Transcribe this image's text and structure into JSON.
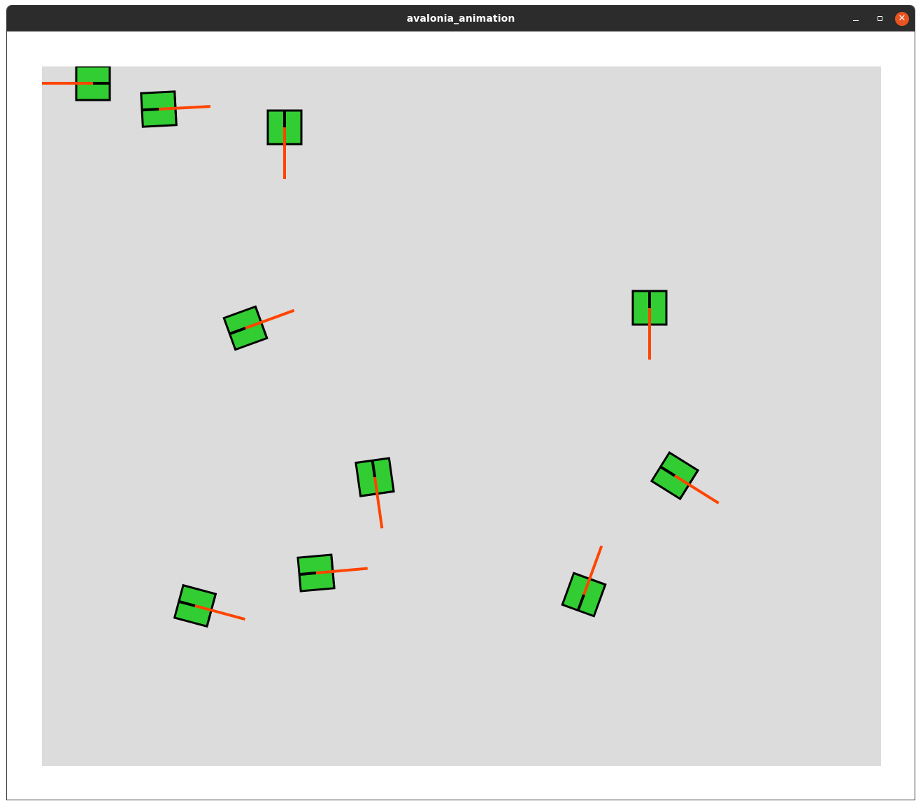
{
  "window": {
    "title": "avalonia_animation",
    "controls": {
      "minimize_icon": "minimize-icon",
      "maximize_icon": "maximize-icon",
      "close_icon": "close-icon",
      "close_glyph": "✕"
    }
  },
  "scene": {
    "background_color": "#dcdcdc",
    "body_color": "#32cd32",
    "outline_color": "#000000",
    "barrel_color": "#ff4500"
  }
}
